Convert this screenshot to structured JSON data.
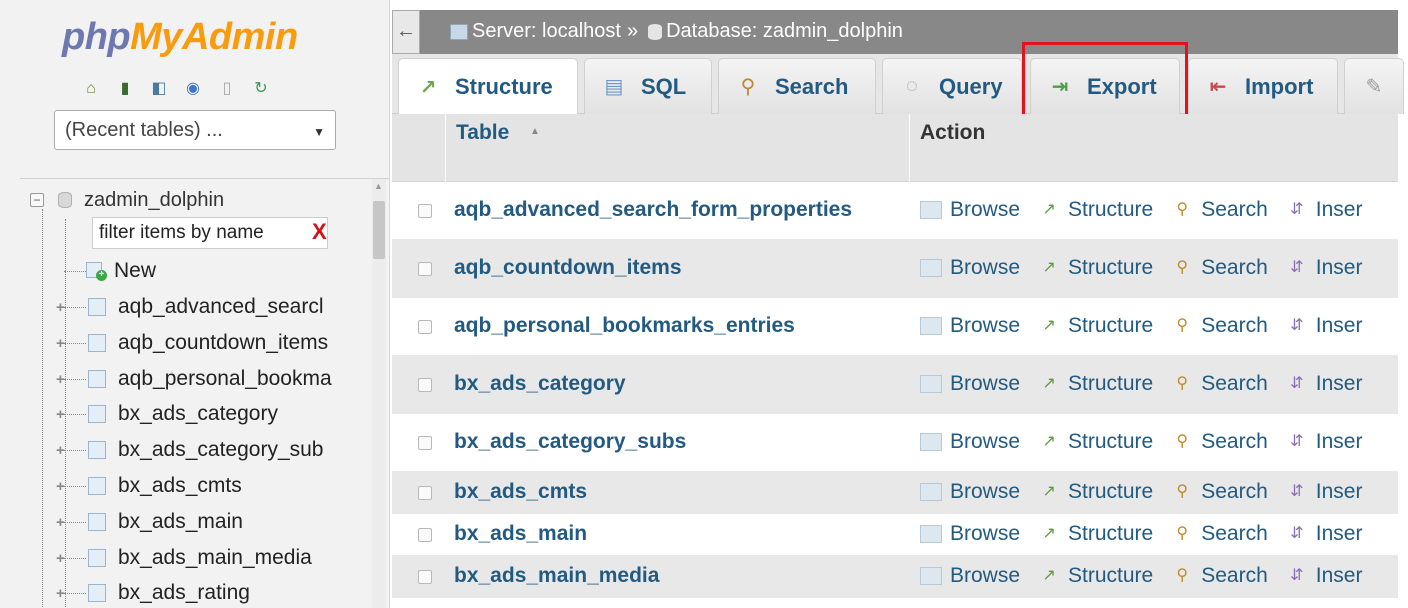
{
  "logo": {
    "php": "php",
    "my": "My",
    "admin": "Admin"
  },
  "nav_icons": [
    "home-icon",
    "exit-icon",
    "sql-query-icon",
    "help-icon",
    "documentation-icon",
    "reload-icon"
  ],
  "recent_tables": {
    "value": "(Recent tables) ..."
  },
  "tree": {
    "database": "zadmin_dolphin",
    "filter_value": "filter items by name",
    "new_label": "New",
    "items": [
      "aqb_advanced_searcl",
      "aqb_countdown_items",
      "aqb_personal_bookma",
      "bx_ads_category",
      "bx_ads_category_sub",
      "bx_ads_cmts",
      "bx_ads_main",
      "bx_ads_main_media",
      "bx_ads_rating"
    ]
  },
  "breadcrumb": {
    "server": "Server: localhost",
    "separator": "»",
    "database": "Database: zadmin_dolphin"
  },
  "tabs": [
    {
      "label": "Structure",
      "icon": "structure-icon",
      "active": true
    },
    {
      "label": "SQL",
      "icon": "sql-icon"
    },
    {
      "label": "Search",
      "icon": "search-icon"
    },
    {
      "label": "Query",
      "icon": "query-icon"
    },
    {
      "label": "Export",
      "icon": "export-icon",
      "highlighted": true
    },
    {
      "label": "Import",
      "icon": "import-icon"
    },
    {
      "label": "",
      "icon": "wrench-icon"
    }
  ],
  "table": {
    "header_table": "Table",
    "header_action": "Action",
    "action_labels": {
      "browse": "Browse",
      "structure": "Structure",
      "search": "Search",
      "insert": "Inser"
    },
    "rows": [
      "aqb_advanced_search_form_properties",
      "aqb_countdown_items",
      "aqb_personal_bookmarks_entries",
      "bx_ads_category",
      "bx_ads_category_subs",
      "bx_ads_cmts",
      "bx_ads_main",
      "bx_ads_main_media"
    ]
  },
  "colors": {
    "link": "#235a81",
    "highlight_box": "#e0141c",
    "topbar": "#888888"
  }
}
